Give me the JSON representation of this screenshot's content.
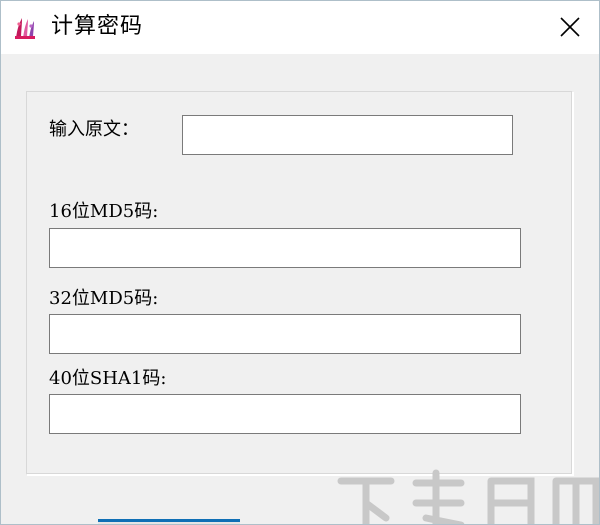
{
  "window": {
    "title": "计算密码",
    "close_symbol": "✕"
  },
  "icons": {
    "app": "app-logo-icon",
    "close": "close-icon"
  },
  "form": {
    "source_label": "输入原文：",
    "source_value": "",
    "md5_16_label": "16位MD5码:",
    "md5_16_value": "",
    "md5_32_label": "32位MD5码:",
    "md5_32_value": "",
    "sha1_40_label": "40位SHA1码:",
    "sha1_40_value": ""
  },
  "colors": {
    "button_accent": "#0f6fb5",
    "icon_accent": "#c2185b"
  }
}
